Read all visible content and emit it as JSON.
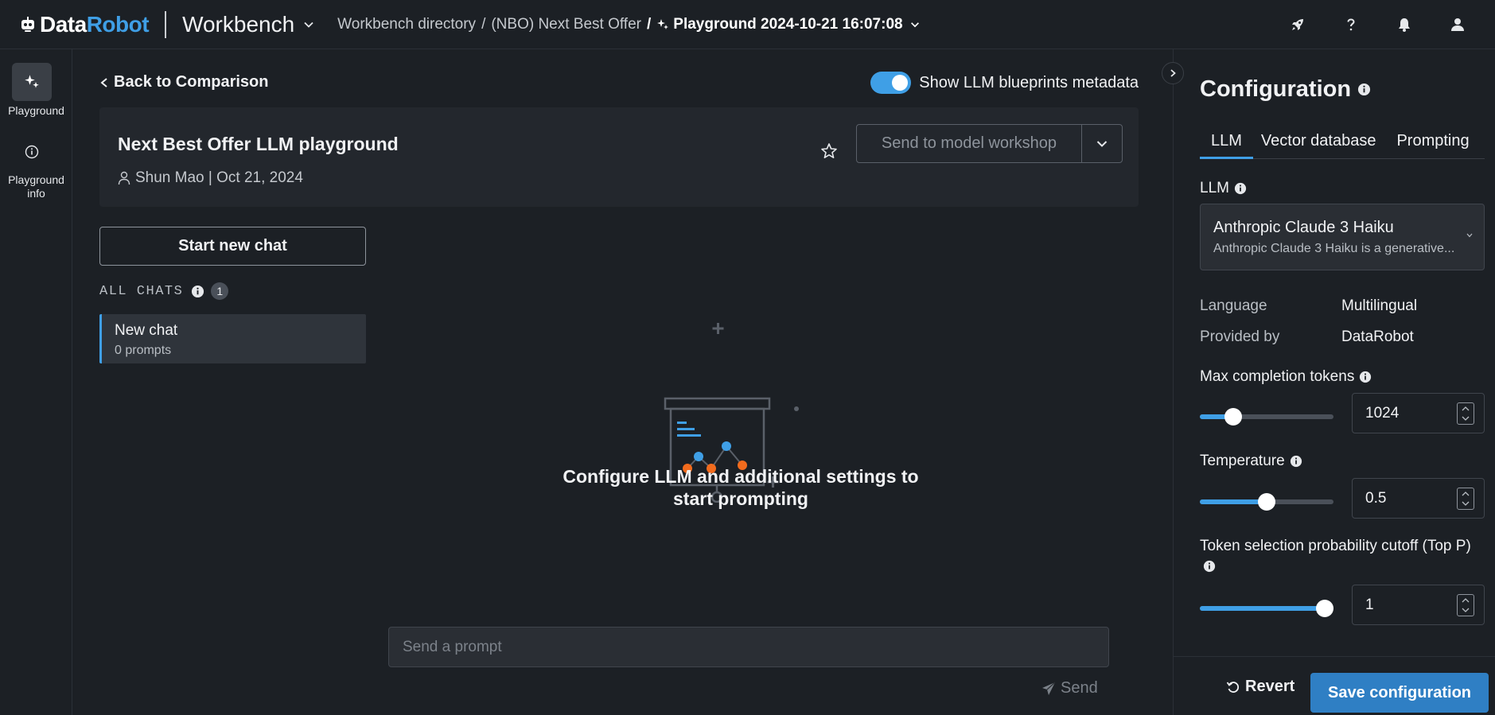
{
  "brand": {
    "data": "Data",
    "robot": "Robot"
  },
  "app": {
    "title": "Workbench"
  },
  "breadcrumbs": {
    "items": [
      "Workbench directory",
      "(NBO) Next Best Offer"
    ],
    "current": "Playground 2024-10-21 16:07:08",
    "separator": "/"
  },
  "top_icons": [
    "rocket-icon",
    "help-icon",
    "bell-icon",
    "user-icon"
  ],
  "rail": {
    "items": [
      {
        "label": "Playground",
        "icon": "sparkle-icon",
        "active": true
      },
      {
        "label": "Playground info",
        "icon": "info-icon",
        "active": false
      }
    ]
  },
  "main": {
    "back_label": "Back to Comparison",
    "toggle_label": "Show LLM blueprints metadata",
    "toggle_on": true,
    "playground": {
      "title": "Next Best Offer LLM playground",
      "meta": "Shun Mao | Oct 21, 2024",
      "send_label": "Send to model workshop"
    },
    "new_chat_label": "Start new chat",
    "all_chats_label": "ALL CHATS",
    "chat_count": "1",
    "chats": [
      {
        "title": "New chat",
        "subtitle": "0 prompts"
      }
    ],
    "empty_line1": "Configure LLM and additional settings to",
    "empty_line2": "start prompting",
    "prompt_placeholder": "Send a prompt",
    "send_button": "Send"
  },
  "config": {
    "title": "Configuration",
    "tabs": [
      {
        "label": "LLM",
        "active": true
      },
      {
        "label": "Vector database",
        "active": false
      },
      {
        "label": "Prompting",
        "active": false
      }
    ],
    "llm_label": "LLM",
    "llm_name": "Anthropic Claude 3 Haiku",
    "llm_desc": "Anthropic Claude 3 Haiku is a generative...",
    "language_key": "Language",
    "language_value": "Multilingual",
    "provider_key": "Provided by",
    "provider_value": "DataRobot",
    "max_tokens_label": "Max completion tokens",
    "max_tokens_value": "1024",
    "max_tokens_fraction": 0.25,
    "temperature_label": "Temperature",
    "temperature_value": "0.5",
    "temperature_fraction": 0.5,
    "topp_label": "Token selection probability cutoff (Top P)",
    "topp_value": "1",
    "topp_fraction": 1.0,
    "revert_label": "Revert",
    "save_label": "Save configuration"
  },
  "colors": {
    "accent": "#3f9fe6",
    "background": "#1c2025",
    "save_button": "#2f7fc4",
    "chart_orange": "#f26b1d"
  }
}
